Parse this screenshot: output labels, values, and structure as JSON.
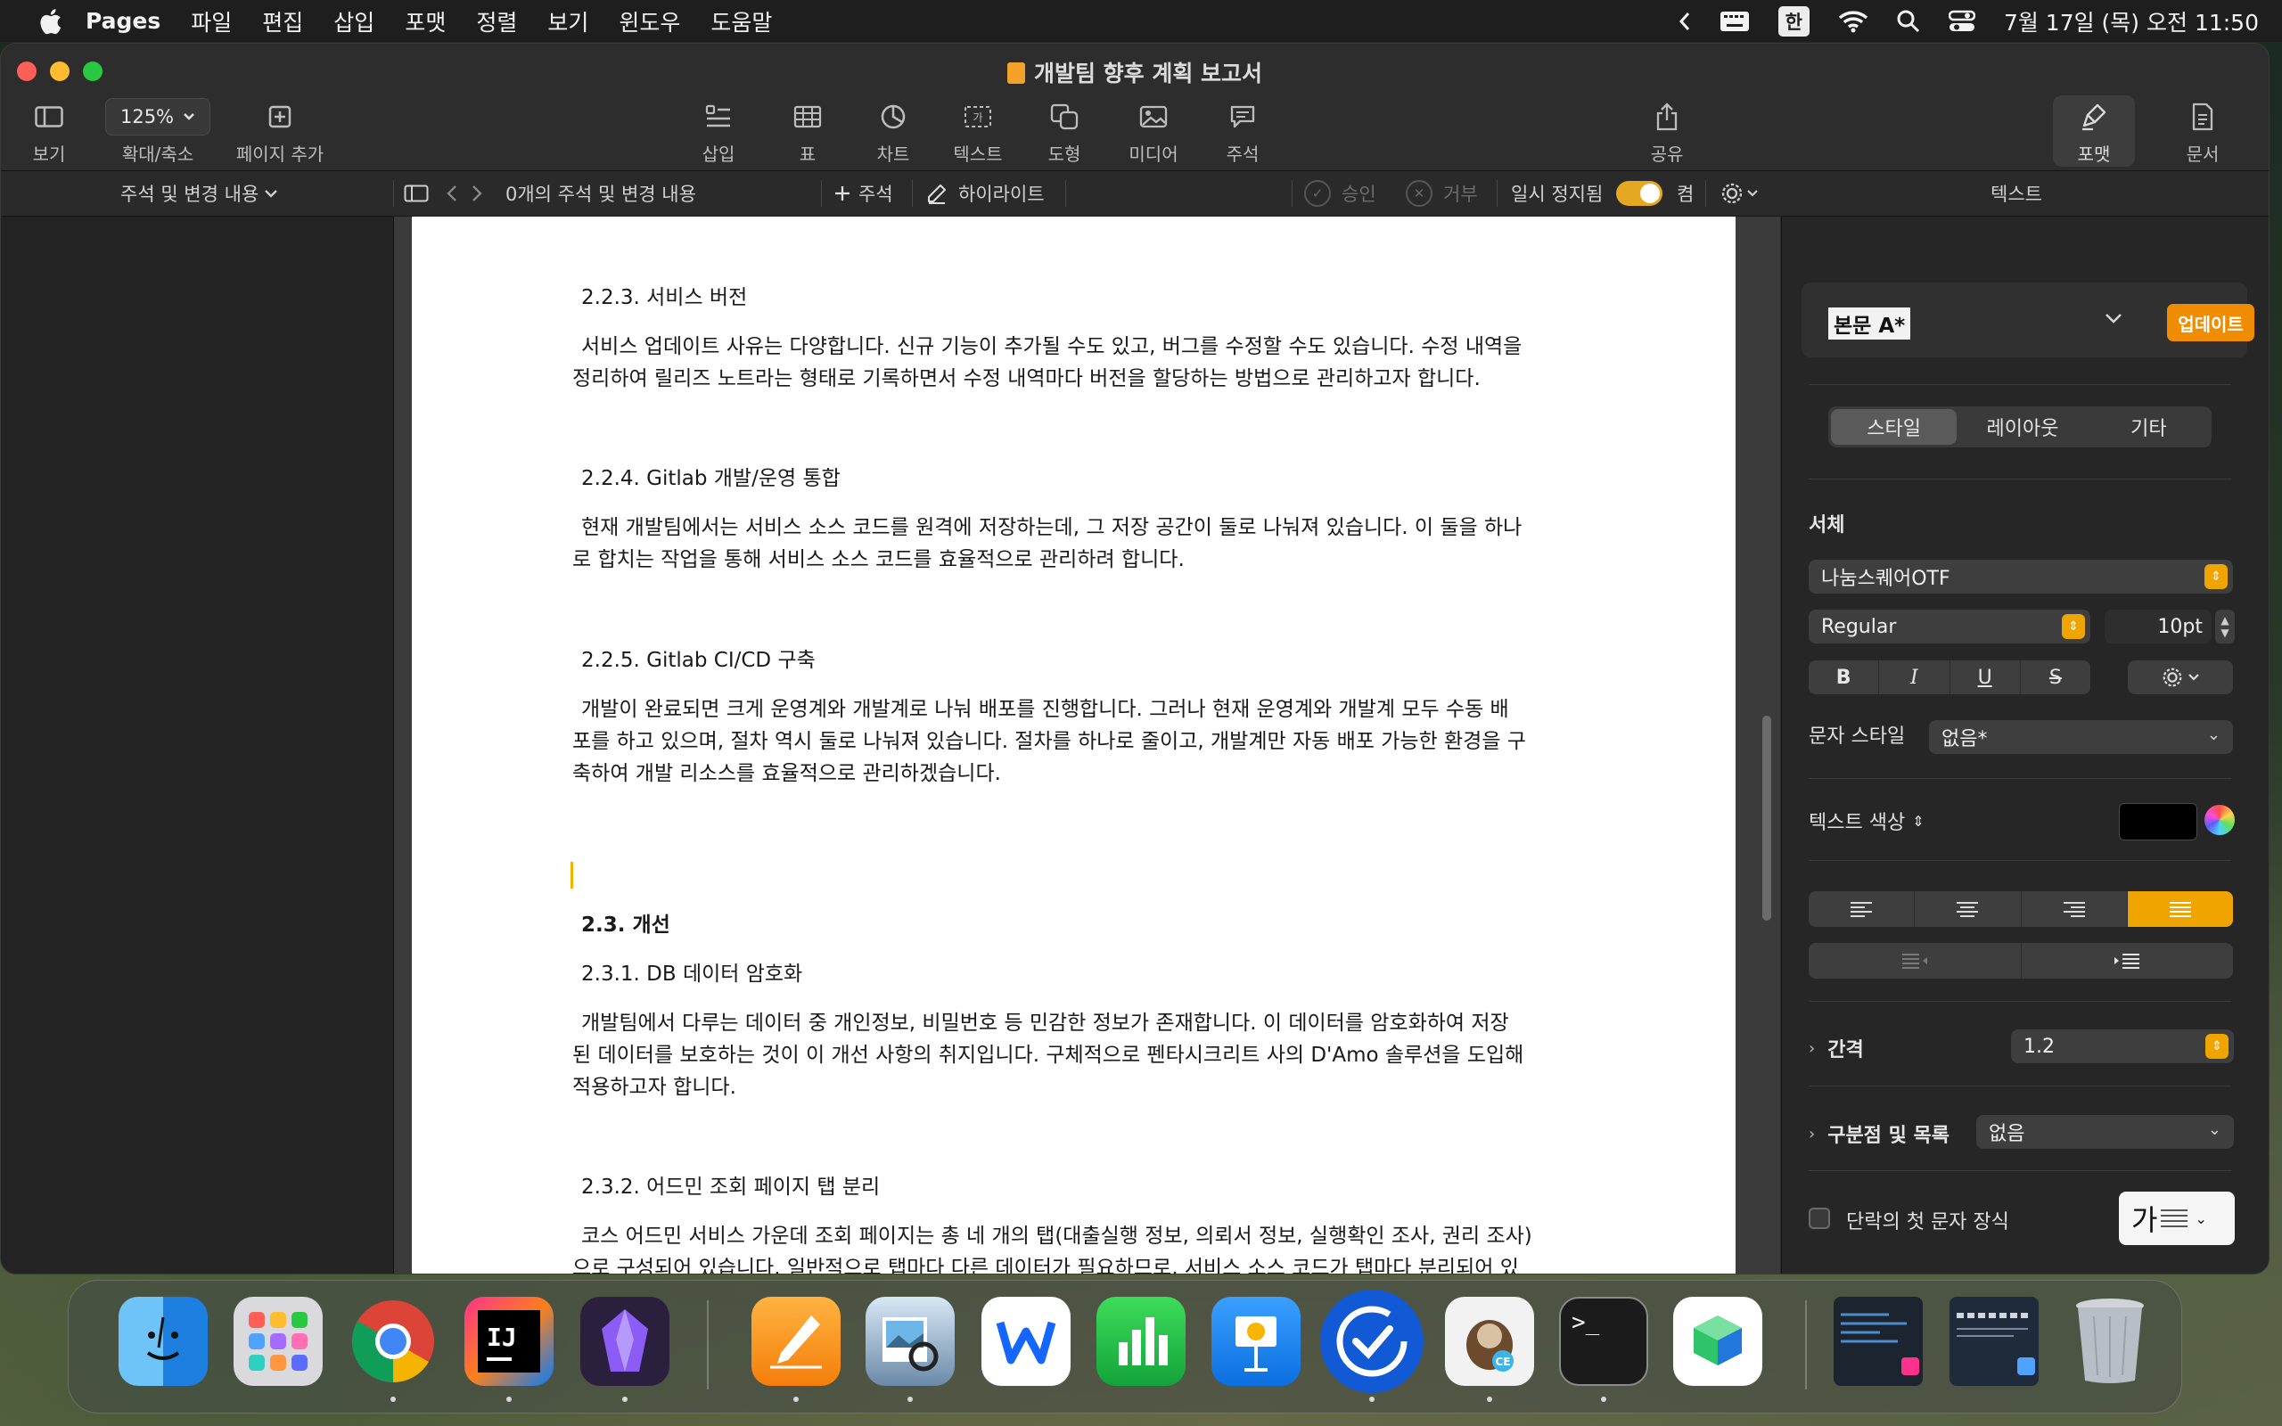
{
  "menubar": {
    "app_name": "Pages",
    "items": [
      "파일",
      "편집",
      "삽입",
      "포맷",
      "정렬",
      "보기",
      "윈도우",
      "도움말"
    ],
    "ime": "한",
    "datetime": "7월 17일 (목) 오전 11:50"
  },
  "window": {
    "title": "개발팀 향후 계획 보고서"
  },
  "toolbar": {
    "view": "보기",
    "zoom_value": "125%",
    "zoom": "확대/축소",
    "add_page": "페이지 추가",
    "insert": "삽입",
    "table": "표",
    "chart": "차트",
    "text": "텍스트",
    "shape": "도형",
    "media": "미디어",
    "comment": "주석",
    "share": "공유",
    "format": "포맷",
    "document": "문서"
  },
  "subbar": {
    "comments_changes": "주석 및 변경 내용",
    "count": "0개의 주석 및 변경 내용",
    "add_comment": "주석",
    "highlight": "하이라이트",
    "accept": "승인",
    "reject": "거부",
    "pause": "일시 정지됨",
    "on": "켬",
    "inspector_tab": "텍스트"
  },
  "document": {
    "h_223": "2.2.3. 서비스 버전",
    "p_223_1": "서비스 업데이트 사유는 다양합니다. 신규 기능이 추가될 수도 있고, 버그를 수정할 수도 있습니다. 수정 내역을",
    "p_223_2": "정리하여 릴리즈 노트라는 형태로 기록하면서 수정 내역마다 버전을 할당하는 방법으로 관리하고자 합니다.",
    "h_224": "2.2.4. Gitlab 개발/운영 통합",
    "p_224_1": "현재 개발팀에서는 서비스 소스 코드를 원격에 저장하는데, 그 저장 공간이 둘로 나눠져 있습니다. 이 둘을 하나",
    "p_224_2": "로 합치는 작업을 통해 서비스 소스 코드를 효율적으로 관리하려 합니다.",
    "h_225": "2.2.5. Gitlab CI/CD 구축",
    "p_225_1": "개발이 완료되면 크게 운영계와 개발계로 나눠 배포를 진행합니다. 그러나 현재 운영계와 개발계 모두 수동 배",
    "p_225_2": "포를 하고 있으며, 절차 역시 둘로 나눠져 있습니다. 절차를 하나로 줄이고, 개발계만 자동 배포 가능한 환경을 구",
    "p_225_3": "축하여 개발 리소스를 효율적으로 관리하겠습니다.",
    "h_23": "2.3. 개선",
    "h_231": "2.3.1. DB 데이터 암호화",
    "p_231_1": "개발팀에서 다루는 데이터 중 개인정보, 비밀번호 등 민감한 정보가 존재합니다. 이 데이터를 암호화하여 저장",
    "p_231_2": "된 데이터를 보호하는 것이 이 개선 사항의 취지입니다. 구체적으로 펜타시크리트 사의 D'Amo 솔루션을 도입해",
    "p_231_3": "적용하고자 합니다.",
    "h_232": "2.3.2. 어드민 조회 페이지 탭 분리",
    "p_232_1": "코스 어드민 서비스 가운데 조회 페이지는 총 네 개의 탭(대출실행 정보, 의뢰서 정보, 실행확인 조사, 권리 조사)",
    "p_232_2": "으로 구성되어 있습니다. 일반적으로 탭마다 다른 데이터가 필요하므로, 서비스 소스 코드가 탭마다 분리되어 있"
  },
  "inspector": {
    "paragraph_style": "본문 A*",
    "update": "업데이트",
    "tabs": [
      "스타일",
      "레이아웃",
      "기타"
    ],
    "font_label": "서체",
    "font_name": "나눔스퀘어OTF",
    "font_weight": "Regular",
    "font_size": "10pt",
    "bold": "B",
    "italic": "I",
    "underline": "U",
    "strike": "S",
    "char_style_label": "문자 스타일",
    "char_style_value": "없음*",
    "text_color_label": "텍스트 색상",
    "spacing_label": "간격",
    "spacing_value": "1.2",
    "bullets_label": "구분점 및 목록",
    "bullets_value": "없음",
    "dropcap_label": "단락의 첫 문자 장식",
    "dropcap_glyph": "가"
  },
  "colors": {
    "accent": "#f0a400",
    "text_color_swatch": "#000000"
  }
}
